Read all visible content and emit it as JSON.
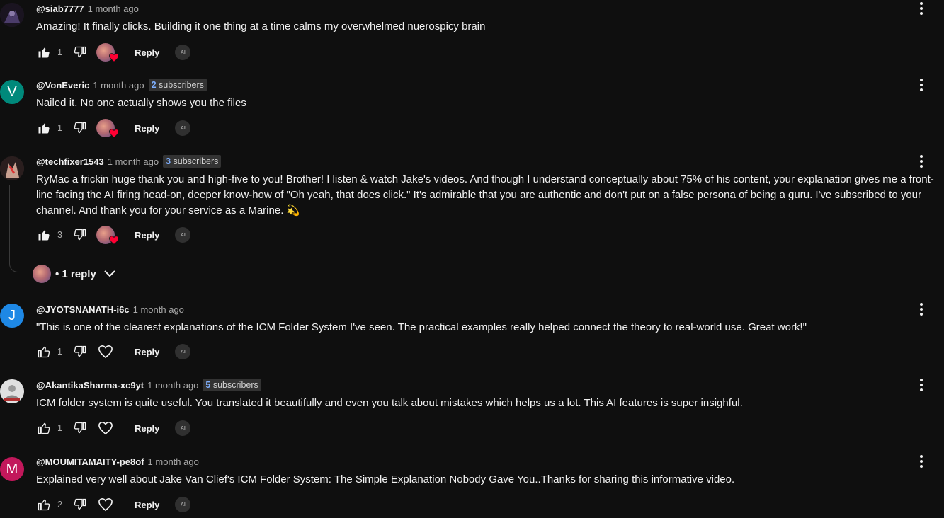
{
  "comments": [
    {
      "handle": "@siab7777",
      "time": "1 month ago",
      "badge_num": "",
      "badge_text": "",
      "text": "Amazing! It finally clicks. Building it one thing at a time calms my overwhelmed nuerospicy brain",
      "likes": "1",
      "liked": true,
      "hearted": true,
      "avatar_letter": "",
      "avatar_color": "#2a2030"
    },
    {
      "handle": "@VonEveric",
      "time": "1 month ago",
      "badge_num": "2",
      "badge_text": "subscribers",
      "text": "Nailed it. No one actually shows you the files",
      "likes": "1",
      "liked": true,
      "hearted": true,
      "avatar_letter": "V",
      "avatar_color": "#00897b"
    },
    {
      "handle": "@techfixer1543",
      "time": "1 month ago",
      "badge_num": "3",
      "badge_text": "subscribers",
      "text": "RyMac a frickin huge thank you and high-five to you! Brother! I listen & watch Jake's videos. And though I understand conceptually about 75% of his content, your explanation gives me a front-line facing the AI firing head-on, deeper know-how of \"Oh yeah, that does click.\" It's admirable that you are authentic and don't put on a false persona of being a guru. I've subscribed to your channel. And thank you for your service as a Marine. 💫",
      "likes": "3",
      "liked": true,
      "hearted": true,
      "avatar_letter": "",
      "avatar_color": "#5a3a3a"
    },
    {
      "handle": "@JYOTSNANATH-i6c",
      "time": "1 month ago",
      "badge_num": "",
      "badge_text": "",
      "text": "\"This is one of the clearest explanations of the ICM Folder System I've seen. The practical examples really helped connect the theory to real-world use. Great work!\"",
      "likes": "1",
      "liked": false,
      "hearted": false,
      "avatar_letter": "J",
      "avatar_color": "#1e88e5"
    },
    {
      "handle": "@AkantikaSharma-xc9yt",
      "time": "1 month ago",
      "badge_num": "5",
      "badge_text": "subscribers",
      "text": "ICM folder system is quite useful. You translated it beautifully and even you talk about mistakes which helps us a lot. This AI features is super insighful.",
      "likes": "1",
      "liked": false,
      "hearted": false,
      "avatar_letter": "",
      "avatar_color": "#cfcfcf"
    },
    {
      "handle": "@MOUMITAMAITY-pe8of",
      "time": "1 month ago",
      "badge_num": "",
      "badge_text": "",
      "text": "Explained very well about Jake Van Clief's ICM Folder System: The Simple Explanation Nobody Gave You..Thanks for sharing this informative video.",
      "likes": "2",
      "liked": false,
      "hearted": false,
      "avatar_letter": "M",
      "avatar_color": "#c2185b"
    }
  ],
  "reply_label": "Reply",
  "replies_toggle": "• 1 reply",
  "sparkle_label": "AI",
  "colors": {
    "background": "#0f0f0f",
    "text": "#f1f1f1",
    "muted": "#aaaaaa",
    "heart": "#ff0033",
    "badge_number": "#7fb0ff"
  }
}
